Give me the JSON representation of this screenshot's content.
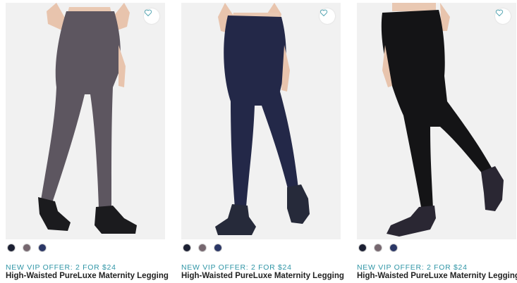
{
  "products": [
    {
      "offer": "NEW VIP OFFER: 2 FOR $24",
      "title": "High-Waisted PureLuxe Maternity Legging",
      "legging_color": "#5d5660",
      "shoe_color": "#1b1b1e",
      "swatches": [
        "#1c2033",
        "#76676f",
        "#2b3766"
      ]
    },
    {
      "offer": "NEW VIP OFFER: 2 FOR $24",
      "title": "High-Waisted PureLuxe Maternity Legging",
      "legging_color": "#232848",
      "shoe_color": "#262a3a",
      "swatches": [
        "#1c2033",
        "#76676f",
        "#2b3766"
      ]
    },
    {
      "offer": "NEW VIP OFFER: 2 FOR $24",
      "title": "High-Waisted PureLuxe Maternity Legging",
      "legging_color": "#141416",
      "shoe_color": "#2a2733",
      "swatches": [
        "#1c2033",
        "#76676f",
        "#2b3766"
      ]
    }
  ],
  "icons": {
    "wishlist": "heart-outline-icon"
  },
  "colors": {
    "accent": "#2f95a6",
    "wishlist_icon": "#5aa8b5",
    "photo_bg": "#f1f1f1"
  }
}
